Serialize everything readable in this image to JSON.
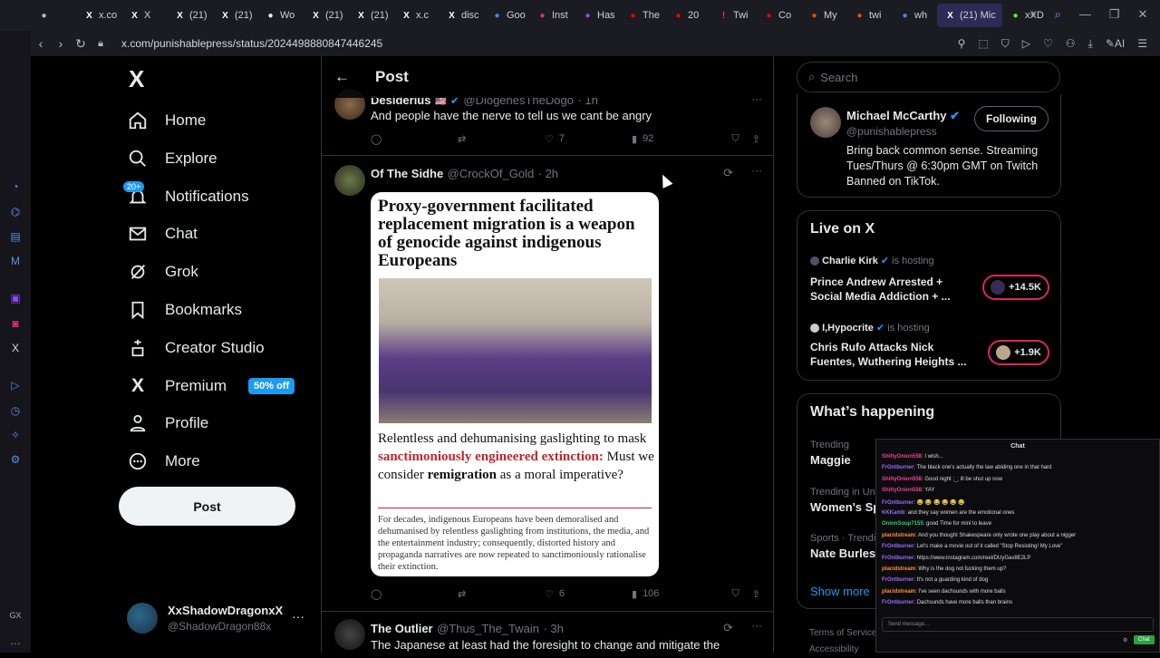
{
  "browser": {
    "tabs": [
      {
        "label": "",
        "icon": "window-icon",
        "color": "#bbbbbb"
      },
      {
        "label": "x.co",
        "icon": "x-icon",
        "color": "#ffffff"
      },
      {
        "label": "X",
        "icon": "x-icon",
        "color": "#ffffff"
      },
      {
        "label": "(21)",
        "icon": "x-icon",
        "color": "#ffffff"
      },
      {
        "label": "(21)",
        "icon": "x-icon",
        "color": "#ffffff"
      },
      {
        "label": "Wo",
        "icon": "play-icon",
        "color": "#ffffff"
      },
      {
        "label": "(21)",
        "icon": "x-icon",
        "color": "#ffffff"
      },
      {
        "label": "(21)",
        "icon": "x-icon",
        "color": "#ffffff"
      },
      {
        "label": "x.c",
        "icon": "x-icon",
        "color": "#ffffff"
      },
      {
        "label": "disc",
        "icon": "x-icon",
        "color": "#ffffff"
      },
      {
        "label": "Goo",
        "icon": "google-icon",
        "color": "#4285f4"
      },
      {
        "label": "Inst",
        "icon": "instagram-icon",
        "color": "#e1306c"
      },
      {
        "label": "Has",
        "icon": "twitch-icon",
        "color": "#9146ff"
      },
      {
        "label": "The",
        "icon": "youtube-icon",
        "color": "#ff0000"
      },
      {
        "label": "20",
        "icon": "youtube-icon",
        "color": "#ff0000"
      },
      {
        "label": "Twi",
        "icon": "alert-icon",
        "color": "#ff3333"
      },
      {
        "label": "Co",
        "icon": "youtube-icon",
        "color": "#ff0000"
      },
      {
        "label": "My",
        "icon": "reddit-icon",
        "color": "#ff4500"
      },
      {
        "label": "twi",
        "icon": "reddit-icon",
        "color": "#ff4500"
      },
      {
        "label": "wh",
        "icon": "google-icon",
        "color": "#4285f4"
      },
      {
        "label": "(21) Mic",
        "icon": "x-icon",
        "color": "#ffffff",
        "active": true
      },
      {
        "label": "xXD",
        "icon": "kick-icon",
        "color": "#53fc18"
      }
    ],
    "url": "x.com/punishablepress/status/2024498880847446245"
  },
  "nav": {
    "logo": "X",
    "items": [
      "Home",
      "Explore",
      "Notifications",
      "Chat",
      "Grok",
      "Bookmarks",
      "Creator Studio",
      "Premium",
      "Profile",
      "More"
    ],
    "notif_badge": "20+",
    "premium_badge": "50% off",
    "post_button": "Post",
    "account": {
      "name": "XxShadowDragonxX",
      "handle": "@ShadowDragon88x"
    }
  },
  "main": {
    "title": "Post",
    "tweet1": {
      "name": "Desiderius",
      "handle": "@DiogenesTheDogo",
      "time": "· 1h",
      "text": "And people have the nerve to tell us we cant be angry",
      "likes": "7",
      "views": "92"
    },
    "tweet2": {
      "name": "Of The Sidhe",
      "handle": "@CrockOf_Gold",
      "time": "· 2h",
      "image": {
        "headline": "Proxy-government facilitated replacement migration is a weapon of genocide against indigenous Europeans",
        "caption_a": "Relentless and dehumanising gaslighting to mask ",
        "caption_red": "sanctimoniously engineered extinction:",
        "caption_b": " Must we consider ",
        "caption_bold": "remigration",
        "caption_c": " as a moral imperative?",
        "body": "For decades, indigenous Europeans have been demoralised and dehumanised by relentless gaslighting from institutions, the media, and the entertainment industry; consequently, distorted history and propaganda narratives are now repeated to sanctimoniously rationalise their extinction."
      },
      "likes": "6",
      "views": "106"
    },
    "tweet3": {
      "name": "The Outlier",
      "handle": "@Thus_The_Twain",
      "time": "· 3h",
      "text": "The Japanese at least had the foresight to change and mitigate the"
    }
  },
  "right": {
    "search_placeholder": "Search",
    "profile": {
      "name": "Michael McCarthy",
      "handle": "@punishablepress",
      "bio": "Bring back common sense. Streaming Tues/Thurs @ 6:30pm GMT on Twitch Banned on TikTok.",
      "follow_label": "Following"
    },
    "live": {
      "title": "Live on X",
      "items": [
        {
          "host": "Charlie Kirk",
          "status": "is hosting",
          "title": "Prince Andrew Arrested + Social Media Addiction + ...",
          "count": "+14.5K"
        },
        {
          "host": "I,Hypocrite",
          "status": "is hosting",
          "title": "Chris Rufo Attacks Nick Fuentes, Wuthering Heights ...",
          "count": "+1.9K"
        }
      ]
    },
    "happening": {
      "title": "What’s happening",
      "items": [
        {
          "context": "Trending",
          "topic": "Maggie"
        },
        {
          "context": "Trending in Uni",
          "topic": "Women's Sp"
        },
        {
          "context": "Sports · Trendi",
          "topic": "Nate Burles"
        }
      ],
      "show_more": "Show more"
    },
    "footer": [
      "Terms of Service",
      "Accessibility"
    ]
  },
  "chat": {
    "title": "Chat",
    "lines": [
      {
        "user": "ShittyOnion558",
        "text": "I wish..."
      },
      {
        "user": "FrOntburner",
        "text": "The black one's actually the law abiding one in that hard"
      },
      {
        "user": "ShittyOnion558",
        "text": "Good night ;_; ill be shut up now"
      },
      {
        "user": "ShittyOnion558",
        "text": "YAY"
      },
      {
        "user": "FrOntburner",
        "text": "😂 😂 😂 😂 😂 😂"
      },
      {
        "user": "KKKamb",
        "text": "and they say women are the emotional ones"
      },
      {
        "user": "OnionSoup7155",
        "text": "good Time for mini to leave"
      },
      {
        "user": "placidstream",
        "text": "And you thought Shakespeare only wrote one play about a nigger"
      },
      {
        "user": "FrOntburner",
        "text": "Let's make a movie out of it called \"Stop Resisting! My Love\""
      },
      {
        "user": "FrOntburner",
        "text": "https://www.instagram.com/reel/DUyGav8E2LP"
      },
      {
        "user": "placidstream",
        "text": "Why is the dog not fucking them up?"
      },
      {
        "user": "FrOntburner",
        "text": "It's not a guarding kind of dog"
      },
      {
        "user": "placidstream",
        "text": "I've seen dachsunds with more balls"
      },
      {
        "user": "FrOntburner",
        "text": "Dachsunds have more balls than brains"
      }
    ],
    "input_placeholder": "Send message...",
    "send_label": "Chat"
  }
}
